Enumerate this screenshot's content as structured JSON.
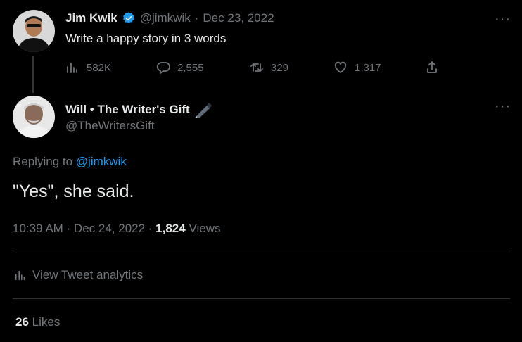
{
  "original_tweet": {
    "author_name": "Jim Kwik",
    "handle": "@jimkwik",
    "separator": "·",
    "date": "Dec 23, 2022",
    "text": "Write a happy story in 3 words",
    "verified": true,
    "actions": {
      "views": "582K",
      "replies": "2,555",
      "retweets": "329",
      "likes": "1,317"
    }
  },
  "reply_tweet": {
    "author_name": "Will • The Writer's Gift",
    "handle": "@TheWritersGift",
    "replying_prefix": "Replying to",
    "replying_to": "@jimkwik",
    "text": "\"Yes\", she said.",
    "time": "10:39 AM · Dec 24, 2022 · ",
    "views_count": "1,824",
    "views_label": " Views"
  },
  "analytics": {
    "label": "View Tweet analytics"
  },
  "likes": {
    "count": "26",
    "label": " Likes"
  },
  "colors": {
    "accent": "#1d9bf0",
    "muted": "#71767b",
    "text": "#e7e9ea",
    "background": "#000000"
  }
}
